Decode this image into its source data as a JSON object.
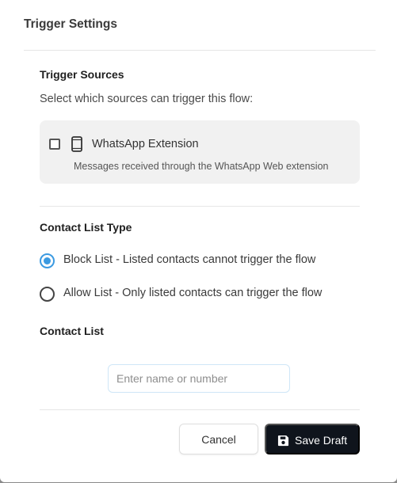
{
  "dialog": {
    "title": "Trigger Settings"
  },
  "trigger_sources": {
    "heading": "Trigger Sources",
    "subtitle": "Select which sources can trigger this flow:",
    "sources": [
      {
        "label": "WhatsApp Extension",
        "description": "Messages received through the WhatsApp Web extension",
        "checked": false,
        "icon": "phone-icon"
      }
    ]
  },
  "contact_list_type": {
    "heading": "Contact List Type",
    "options": [
      {
        "label": "Block List - Listed contacts cannot trigger the flow",
        "selected": true
      },
      {
        "label": "Allow List - Only listed contacts can trigger the flow",
        "selected": false
      }
    ]
  },
  "contact_list": {
    "heading": "Contact List",
    "input_placeholder": "Enter name or number",
    "input_value": ""
  },
  "footer": {
    "cancel_label": "Cancel",
    "save_label": "Save Draft",
    "save_icon": "floppy-disk-icon"
  },
  "colors": {
    "accent": "#3b9ae1",
    "primary_button": "#0f141c",
    "card_background": "#f1f1f1"
  }
}
